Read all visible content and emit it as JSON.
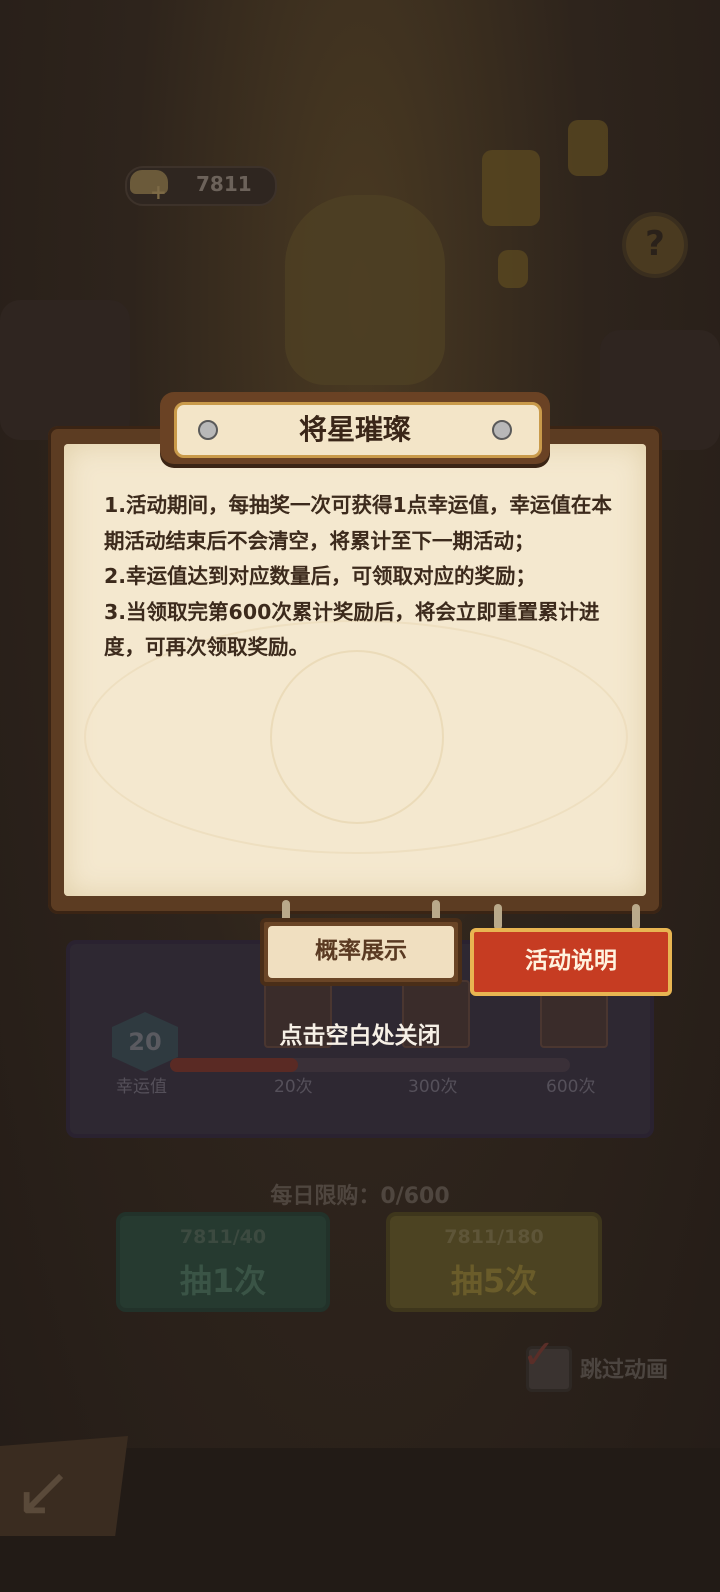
{
  "currency": {
    "value": "7811",
    "icon": "gold-ingot-icon"
  },
  "help": {
    "label": "?"
  },
  "popup": {
    "title": "将星璀璨",
    "rules": [
      "1.活动期间，每抽奖一次可获得1点幸运值，幸运值在本期活动结束后不会清空，将累计至下一期活动；",
      "2.幸运值达到对应数量后，可领取对应的奖励；",
      "3.当领取完第600次累计奖励后，将会立即重置累计进度，可再次领取奖励。"
    ],
    "tabs": {
      "probability": "概率展示",
      "rules": "活动说明"
    },
    "close_hint": "点击空白处关闭"
  },
  "background": {
    "luck_value": "20",
    "luck_label": "幸运值",
    "milestones": [
      "20次",
      "300次",
      "600次"
    ],
    "daily_limit": "每日限购：0/600",
    "draw_one": {
      "cost": "7811/40",
      "label": "抽1次"
    },
    "draw_five": {
      "cost": "7811/180",
      "label": "抽5次"
    },
    "skip_animation": "跳过动画"
  },
  "colors": {
    "accent_red": "#c63c22",
    "paper": "#f4e8cf",
    "frame_brown": "#5c3c22"
  }
}
